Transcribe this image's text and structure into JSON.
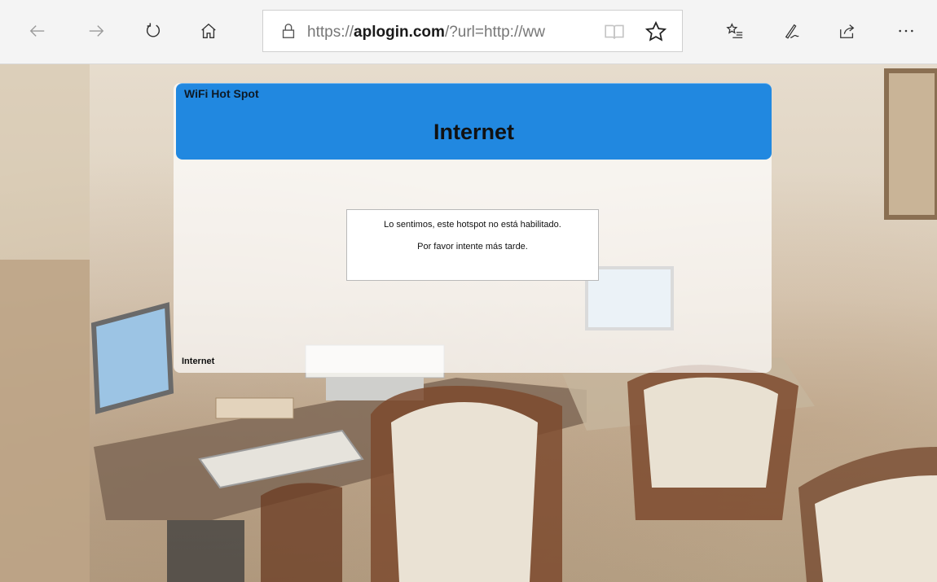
{
  "browser": {
    "url_prefix": "https://",
    "url_domain": "aplogin.com",
    "url_rest": "/?url=http://ww"
  },
  "hotspot": {
    "brand": "WiFi Hot Spot",
    "title": "Internet",
    "message_line1": "Lo sentimos, este hotspot no está habilitado.",
    "message_line2": "Por favor intente más tarde.",
    "footer": "Internet",
    "header_color": "#2188e0"
  }
}
